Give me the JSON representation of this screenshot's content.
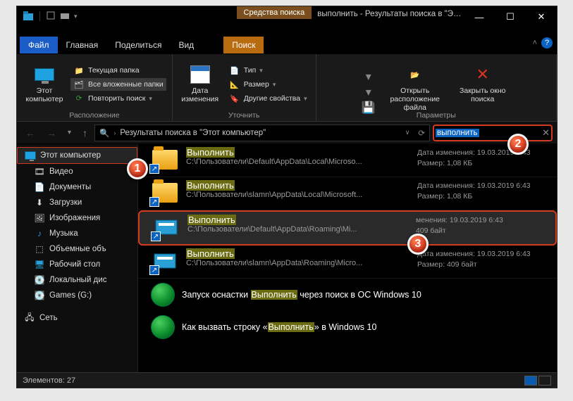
{
  "titlebar": {
    "tools_tab": "Средства поиска",
    "title": "выполнить - Результаты поиска в \"Это..."
  },
  "tabs": {
    "file": "Файл",
    "home": "Главная",
    "share": "Поделиться",
    "view": "Вид",
    "search": "Поиск"
  },
  "ribbon": {
    "location": {
      "this_pc": "Этот компьютер",
      "current_folder": "Текущая папка",
      "all_subfolders": "Все вложенные папки",
      "repeat_search": "Повторить поиск",
      "group": "Расположение"
    },
    "refine": {
      "date_modified": "Дата изменения",
      "type": "Тип",
      "size": "Размер",
      "other_props": "Другие свойства",
      "group": "Уточнить"
    },
    "options": {
      "open_location": "Открыть расположение файла",
      "close_search": "Закрыть окно поиска",
      "group": "Параметры"
    }
  },
  "address": {
    "text": "Результаты поиска в \"Этот компьютер\""
  },
  "search": {
    "value": "выполнить"
  },
  "sidebar": {
    "this_pc": "Этот компьютер",
    "videos": "Видео",
    "documents": "Документы",
    "downloads": "Загрузки",
    "pictures": "Изображения",
    "music": "Музыка",
    "objects3d": "Объемные объ",
    "desktop": "Рабочий стол",
    "localdisk": "Локальный дис",
    "games": "Games (G:)",
    "network": "Сеть"
  },
  "results": [
    {
      "name": "Выполнить",
      "path": "C:\\Пользователи\\Default\\AppData\\Local\\Microso...",
      "date_label": "Дата изменения:",
      "date": "19.03.2019 6:43",
      "size_label": "Размер:",
      "size": "1,08 КБ",
      "icon": "folder-shortcut"
    },
    {
      "name": "Выполнить",
      "path": "C:\\Пользователи\\slamn\\AppData\\Local\\Microsoft...",
      "date_label": "Дата изменения:",
      "date": "19.03.2019 6:43",
      "size_label": "Размер:",
      "size": "1,08 КБ",
      "icon": "folder-shortcut"
    },
    {
      "name": "Выполнить",
      "path": "C:\\Пользователи\\Default\\AppData\\Roaming\\Mi...",
      "date_label": "менения:",
      "date": "19.03.2019 6:43",
      "size_label": "",
      "size": "409 байт",
      "icon": "run-shortcut"
    },
    {
      "name": "Выполнить",
      "path": "C:\\Пользователи\\slamn\\AppData\\Roaming\\Micro...",
      "date_label": "Дата изменения:",
      "date": "19.03.2019 6:43",
      "size_label": "Размер:",
      "size": "409 байт",
      "icon": "run-shortcut"
    }
  ],
  "webresults": [
    {
      "pre": "Запуск оснастки ",
      "hl": "Выполнить",
      "post": " через поиск в ОС Windows 10"
    },
    {
      "pre": "Как вызвать строку «",
      "hl": "Выполнить",
      "post": "» в Windows 10"
    }
  ],
  "status": {
    "count_label": "Элементов:",
    "count": "27"
  },
  "badges": {
    "b1": "1",
    "b2": "2",
    "b3": "3"
  }
}
